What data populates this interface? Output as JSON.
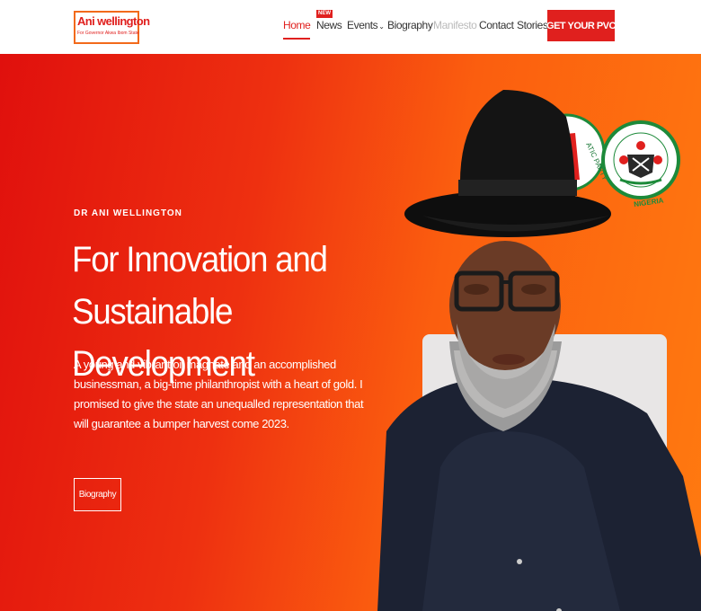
{
  "logo": {
    "title": "Ani wellington",
    "subtitle": "For Governor Akwa Ibom State"
  },
  "nav": {
    "home": "Home",
    "news": "News",
    "news_badge": "NEW",
    "events": "Events",
    "biography": "Biography",
    "manifesto": "Manifesto",
    "contact": "Contact",
    "stories": "Stories",
    "cta": "GET YOUR PVC"
  },
  "hero": {
    "eyebrow": "DR ANI WELLINGTON",
    "headline": "For Innovation and Sustainable Development",
    "description": "A young and vibrant oil magnate and an accomplished businessman, a big-time philanthropist with a heart of gold. I promised to give the state an unequalled representation that will guarantee a bumper harvest come 2023.",
    "button": "Biography"
  },
  "seals": {
    "party_text": "ATIC PARTY",
    "govt_text": "GOVERNMENT OF AKWA IBOM STATE",
    "govt_country": "NIGERIA"
  },
  "colors": {
    "accent": "#e0201e",
    "hero_start": "#e0100d",
    "hero_end": "#ff7a10"
  }
}
